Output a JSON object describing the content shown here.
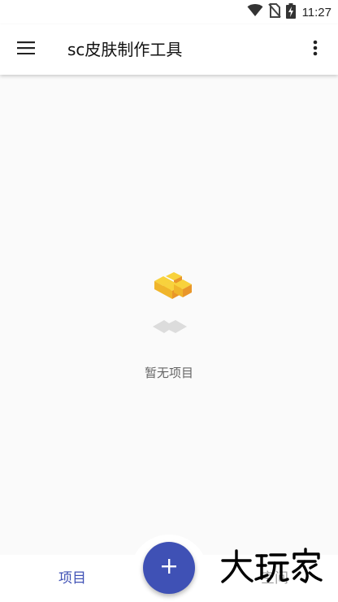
{
  "status_bar": {
    "time": "11:27",
    "icons": [
      "wifi-icon",
      "no-sim-icon",
      "battery-charging-icon"
    ]
  },
  "app_bar": {
    "title": "sc皮肤制作工具",
    "menu_icon": "menu-icon",
    "more_icon": "more-vert-icon"
  },
  "empty_state": {
    "illustration": "empty-blocks-icon",
    "text": "暂无项目"
  },
  "bottom_nav": {
    "tabs": [
      {
        "label": "项目",
        "active": true
      },
      {
        "label": "空间",
        "active": false
      }
    ],
    "fab_icon": "plus-icon"
  },
  "watermark": {
    "text": "大玩家"
  },
  "colors": {
    "primary": "#3f51b5",
    "background": "#fafafa",
    "inactive_tab": "#9e9e9e",
    "block_yellow": "#f6c12a",
    "block_orange": "#e9962a"
  }
}
